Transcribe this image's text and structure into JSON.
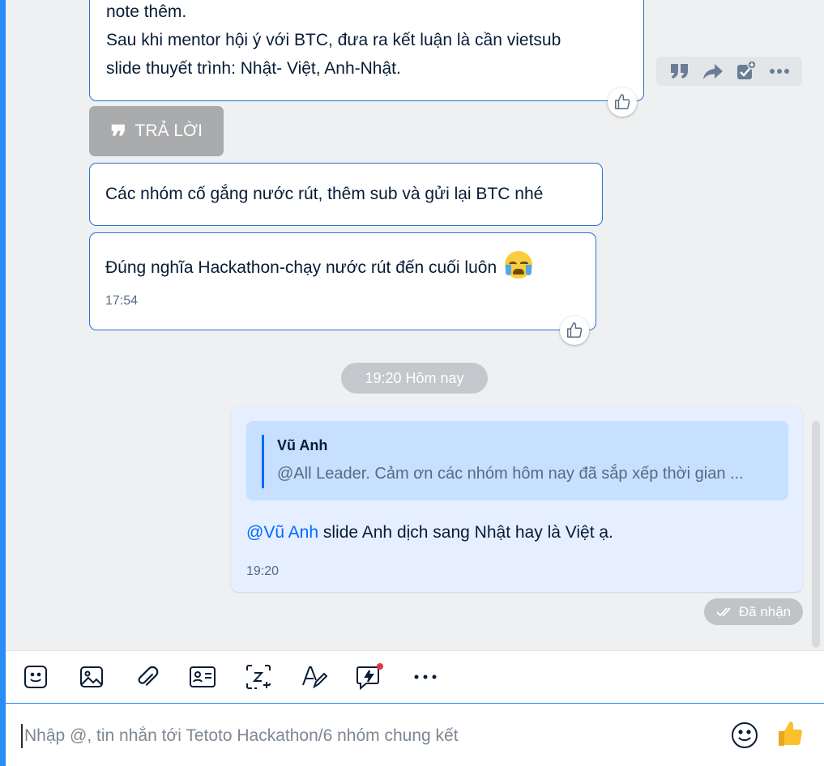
{
  "messages": {
    "msg1_line0": "note thêm.",
    "msg1_line1": "Sau khi mentor hội ý với BTC, đưa ra kết luận là cần vietsub",
    "msg1_line2": "slide thuyết trình: Nhật- Việt, Anh-Nhật.",
    "reply_label": "TRẢ LỜI",
    "msg2": "Các nhóm cố gắng nước rút, thêm sub và gửi lại BTC nhé",
    "msg3": "Đúng nghĩa Hackathon-chạy nước rút đến cuối luôn",
    "msg3_time": "17:54"
  },
  "date_separator": "19:20 Hôm nay",
  "my_message": {
    "quote_author": "Vũ Anh",
    "quote_text": "@All Leader. Cảm ơn các nhóm hôm nay đã sắp xếp thời gian ...",
    "mention": "@Vũ Anh",
    "text": " slide Anh dịch sang Nhật hay là Việt ạ.",
    "time": "19:20",
    "status": "Đã nhận"
  },
  "input": {
    "placeholder": "Nhập @, tin nhắn tới Tetoto Hackathon/6 nhóm chung kết"
  },
  "colors": {
    "accent": "#0068ff",
    "bubble_border": "#2d6fd6",
    "my_bubble": "#e5efff",
    "quote_bg": "#c7e0ff",
    "notification": "#e8343f"
  },
  "icons": {
    "toolbar": [
      "sticker-icon",
      "image-icon",
      "attachment-icon",
      "contact-card-icon",
      "screenshot-icon",
      "text-format-icon",
      "quick-message-icon",
      "more-icon"
    ],
    "message_actions": [
      "quote-icon",
      "forward-icon",
      "add-task-icon",
      "more-options-icon"
    ]
  }
}
